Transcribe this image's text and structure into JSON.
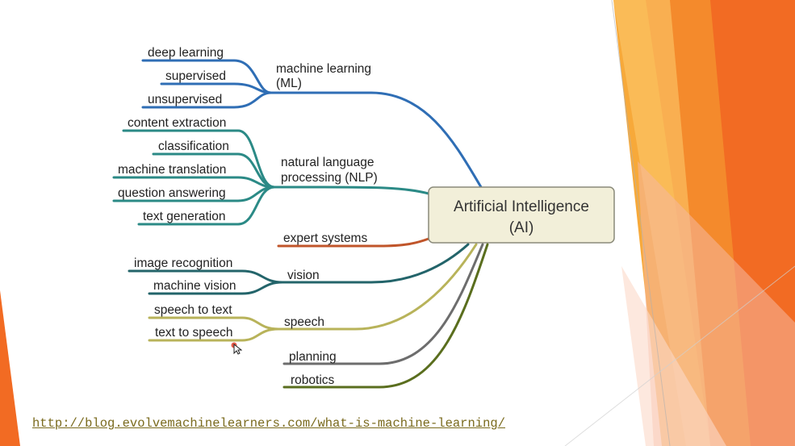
{
  "diagram": {
    "root": {
      "line1": "Artificial Intelligence",
      "line2": "(AI)"
    },
    "branches": [
      {
        "label": "machine learning",
        "label2": "(ML)",
        "color": "#2f6eb5",
        "leaves": [
          "deep learning",
          "supervised",
          "unsupervised"
        ]
      },
      {
        "label": "natural language",
        "label2": "processing (NLP)",
        "color": "#2b8a86",
        "leaves": [
          "content extraction",
          "classification",
          "machine translation",
          "question answering",
          "text generation"
        ]
      },
      {
        "label": "expert systems",
        "color": "#c0552a",
        "leaves": []
      },
      {
        "label": "vision",
        "color": "#23646a",
        "leaves": [
          "image recognition",
          "machine vision"
        ]
      },
      {
        "label": "speech",
        "color": "#b8b35a",
        "leaves": [
          "speech to text",
          "text to speech"
        ]
      },
      {
        "label": "planning",
        "color": "#6d6d6d",
        "leaves": []
      },
      {
        "label": "robotics",
        "color": "#5a6e1e",
        "leaves": []
      }
    ]
  },
  "link": {
    "text": "http://blog.evolvemachinelearners.com/what-is-machine-learning/"
  },
  "theme": {
    "accent_orange": "#f0782a",
    "accent_yellow": "#f6b133",
    "root_fill": "#f2efd9"
  }
}
